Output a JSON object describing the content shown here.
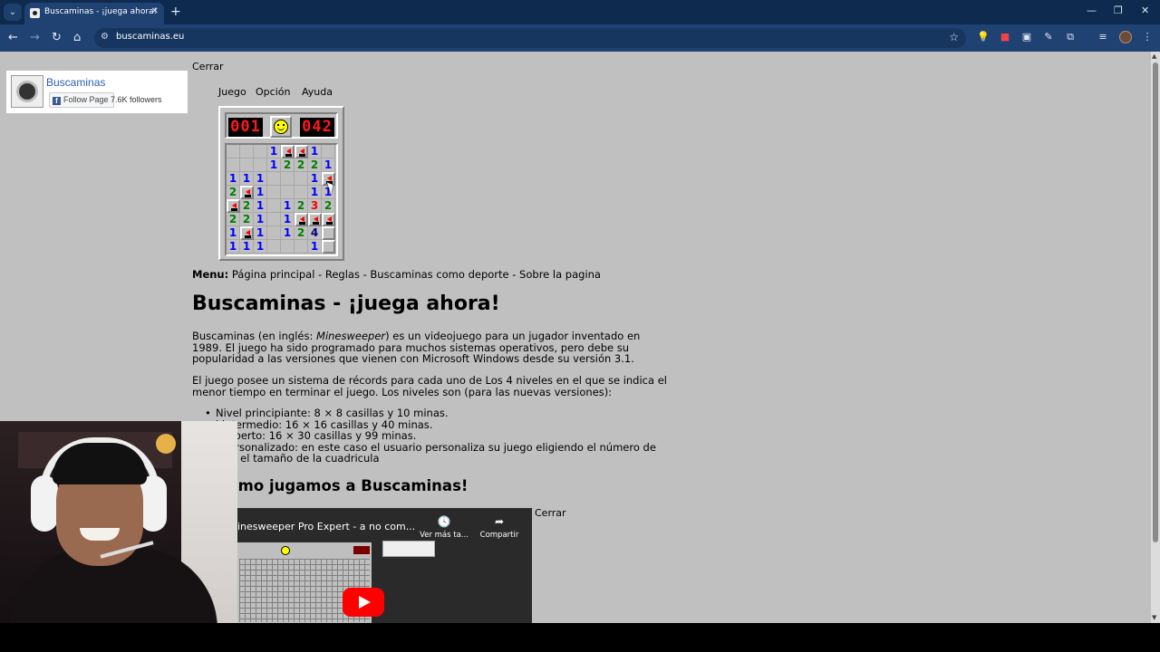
{
  "browser": {
    "tab_title": "Buscaminas - ¡juega ahora!",
    "url": "buscaminas.eu",
    "icons": {
      "tab_menu": "chevron-down-icon",
      "close": "close-icon",
      "new_tab": "plus-icon",
      "back": "arrow-left-icon",
      "forward": "arrow-right-icon",
      "reload": "reload-icon",
      "home": "home-icon",
      "site_info": "tune-icon",
      "bookmark": "star-icon",
      "extensions": "puzzle-icon"
    },
    "glyphs": {
      "tab_menu": "⌄",
      "close": "✕",
      "new_tab": "+",
      "minimize": "—",
      "restore": "❐",
      "window_close": "✕",
      "back": "←",
      "forward": "→",
      "reload": "↻",
      "home": "⌂",
      "site_info": "⚙",
      "star": "☆",
      "bulb": "💡",
      "ext_red": "■",
      "ext_box": "▣",
      "pen": "✎",
      "puzzle": "⧉",
      "media": "≡",
      "menu": "⋮"
    }
  },
  "facebook": {
    "name": "Buscaminas",
    "follow_label": "Follow Page",
    "f_letter": "f",
    "followers": "7.6K followers"
  },
  "game": {
    "close_label": "Cerrar",
    "menu": [
      "Juego",
      "Opción",
      "Ayuda"
    ],
    "mine_counter": "001",
    "timer": "042",
    "grid": [
      [
        "",
        "",
        "",
        "1",
        "F",
        "F",
        "1",
        ""
      ],
      [
        "",
        "",
        "",
        "1",
        "2",
        "2",
        "2",
        "1"
      ],
      [
        "1",
        "1",
        "1",
        "",
        "",
        "",
        "1",
        "F"
      ],
      [
        "2",
        "F",
        "1",
        "",
        "",
        "",
        "1",
        "1"
      ],
      [
        "F",
        "2",
        "1",
        "",
        "1",
        "2",
        "3",
        "2"
      ],
      [
        "2",
        "2",
        "1",
        "",
        "1",
        "F",
        "F",
        "F"
      ],
      [
        "1",
        "F",
        "1",
        "",
        "1",
        "2",
        "4",
        "C"
      ],
      [
        "1",
        "1",
        "1",
        "",
        "",
        "",
        "1",
        "C"
      ]
    ]
  },
  "nav": {
    "label": "Menu:",
    "links": "Página principal - Reglas - Buscaminas como deporte - Sobre la pagina"
  },
  "article": {
    "title": "Buscaminas - ¡juega ahora!",
    "p1_a": "Buscaminas (en inglés: ",
    "p1_em": "Minesweeper",
    "p1_b": ") es un videojuego para un jugador inventado en 1989. El juego ha sido programado para muchos sistemas operativos, pero debe su popularidad a las versiones que vienen con Microsoft Windows desde su versión 3.1.",
    "p2": "El juego posee un sistema de récords para cada uno de Los 4 niveles en el que se indica el menor tiempo en terminar el juego. Los niveles son (para las nuevas versiones):",
    "levels": [
      "Nivel principiante: 8 × 8 casillas y 10 minas.",
      "l intermedio: 16 × 16 casillas y 40 minas.",
      "l experto: 16 × 30 casillas y 99 minas.",
      "l personalizado: en este caso el usuario personaliza su juego eligiendo el número de",
      "as y el tamaño de la cuadricula"
    ],
    "h2": "s como jugamos a Buscaminas!"
  },
  "video": {
    "title": "inesweeper Pro Expert - a no com...",
    "watch_later": "Ver más ta...",
    "share": "Compartir",
    "close_label": "Cerrar"
  },
  "colors": {
    "page_bg": "#c0c0c0",
    "chrome_dark": "#0e2a4e",
    "chrome": "#1f4272",
    "link": "#2c5eb8"
  }
}
